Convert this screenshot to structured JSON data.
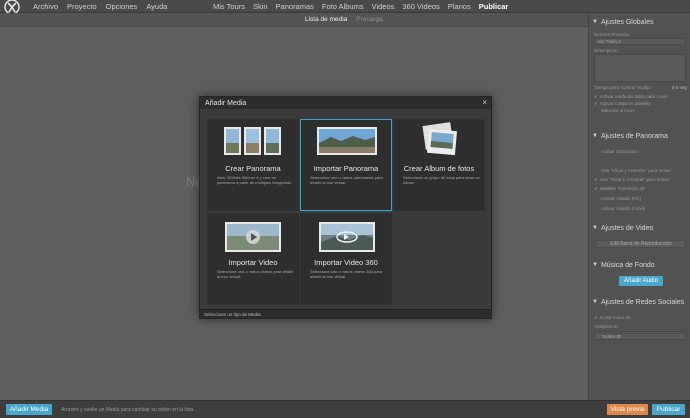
{
  "menu": [
    "Archivo",
    "Proyecto",
    "Opciones",
    "Ayuda"
  ],
  "main_nav": [
    {
      "label": "Mis Tours",
      "active": false
    },
    {
      "label": "Skin",
      "active": false
    },
    {
      "label": "Panoramas",
      "active": false
    },
    {
      "label": "Foto Albums",
      "active": false
    },
    {
      "label": "Videos",
      "active": false
    },
    {
      "label": "360 Videos",
      "active": false
    },
    {
      "label": "Planos",
      "active": false
    },
    {
      "label": "Publicar",
      "active": true
    }
  ],
  "sub_tabs": [
    {
      "label": "Lista de media",
      "active": true
    },
    {
      "label": "Precarga",
      "active": false
    }
  ],
  "main": {
    "placeholder_text": "No"
  },
  "panel": {
    "global": {
      "title": "Ajustes Globales",
      "project_name_label": "Nombre Proyecto:",
      "project_name_value": "Sin Título 3",
      "description_label": "Descripción:",
      "tooltip_time_label": "Tiempo para mostrar Tooltip:",
      "tooltip_time_value": "0.6 seg",
      "options": [
        {
          "label": "Activar rueda del ratón para zoom",
          "checked": true
        },
        {
          "label": "Activar Carga en paralelo",
          "checked": true
        },
        {
          "label": "Silenciar al Inicio",
          "checked": false
        }
      ]
    },
    "panorama": {
      "title": "Ajustes de Panorama",
      "options": [
        {
          "label": "Activar Giroscopio",
          "checked": false
        },
        {
          "label": "Usa \"Clicar y Arrastrar\" para mover",
          "checked": false
        },
        {
          "label": "Usa \"Tocar y Arrastrar\" para mover",
          "checked": true
        },
        {
          "label": "Habilitar Transición 3D",
          "checked": true
        },
        {
          "label": "Activar Alisado (PC)",
          "checked": false
        },
        {
          "label": "Activar Alisado (móvil)",
          "checked": false
        }
      ]
    },
    "video": {
      "title": "Ajustes de Video",
      "edit_bar_label": "Edit Barra de Reproducción"
    },
    "music": {
      "title": "Música de Fondo",
      "add_audio_label": "Añadir Audio"
    },
    "social": {
      "title": "Ajustes de Redes Sociales",
      "options": [
        {
          "label": "Incluir Icono 3D",
          "checked": true
        }
      ],
      "analytics_label": "Analytics ID",
      "twitter_label": "Twitter ID"
    }
  },
  "bottom": {
    "add_media_label": "Añadir Media",
    "hint": "Arrastre y suelte un Media para cambiar su orden en la lista.",
    "preview_label": "Vista previa",
    "publish_label": "Publicar"
  },
  "modal": {
    "title": "Añadir Media",
    "close_glyph": "×",
    "footer": "Seleccione un tipo de Media.",
    "cards": [
      {
        "title": "Crear Panorama",
        "description": "Abre 3DVista Stitcher 4 y crea un panorama a partir de múltiples fotografías.",
        "icon": "stitch-photos-icon",
        "selected": false
      },
      {
        "title": "Importar Panorama",
        "description": "Seleccione uno o varios panoramas para añadir al tour virtual.",
        "icon": "panorama-icon",
        "selected": true
      },
      {
        "title": "Crear Album de fotos",
        "description": "Seleccione un grupo de fotos para crear un Album.",
        "icon": "photo-album-icon",
        "selected": false
      },
      {
        "title": "Importar Video",
        "description": "Seleccione uno o varios videos para añadir al tour virtual.",
        "icon": "video-icon",
        "selected": false
      },
      {
        "title": "Importar Video 360",
        "description": "Seleccione uno o varios videos 360 para añadir al tour virtual.",
        "icon": "video-360-icon",
        "selected": false
      }
    ]
  },
  "colors": {
    "accent_blue": "#4aa7cc",
    "accent_orange": "#e0894d",
    "selection_border": "#3aa3d6"
  }
}
